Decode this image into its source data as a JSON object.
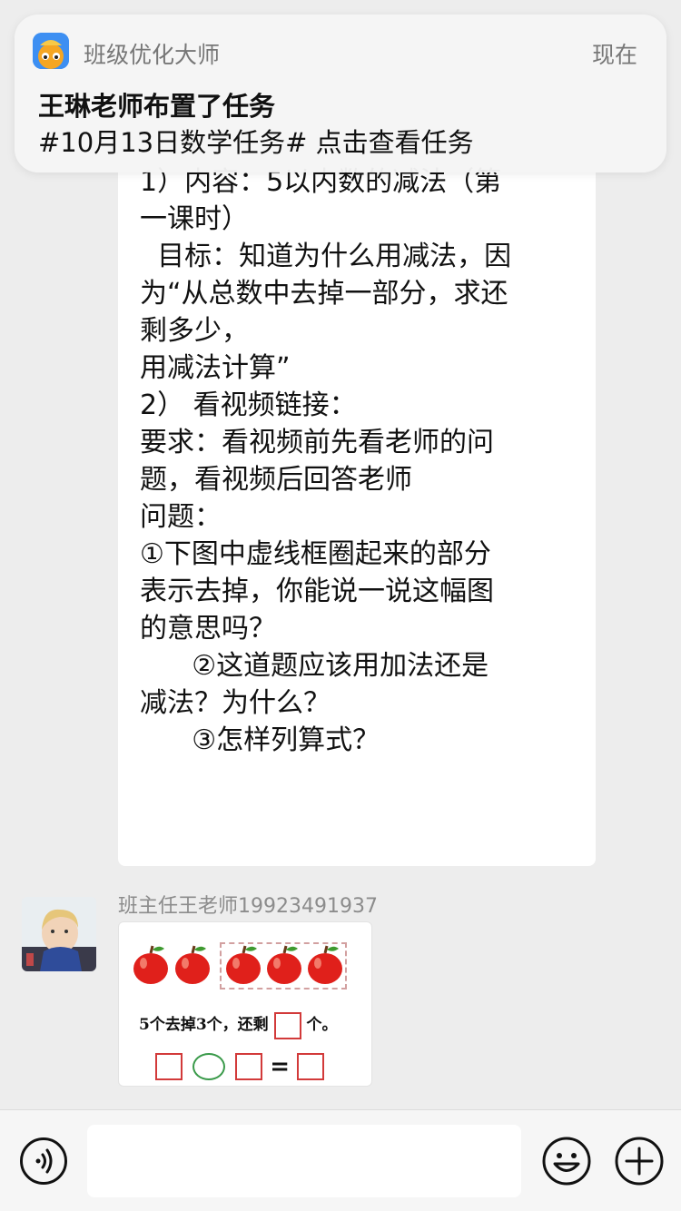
{
  "notification": {
    "app_name": "班级优化大师",
    "time": "现在",
    "title": "王琳老师布置了任务",
    "body": "#10月13日数学任务# 点击查看任务"
  },
  "messages": {
    "task_text_lines": [
      "1）内容：5以内数的减法（第",
      "一课时）",
      "  目标：知道为什么用减法，因",
      "为“从总数中去掉一部分，求还",
      "剩多少，",
      "用减法计算”",
      "2） 看视频链接：",
      "要求：看视频前先看老师的问",
      "题，看视频后回答老师",
      "",
      "问题：",
      "①下图中虚线框圈起来的部分",
      "表示去掉，你能说一说这幅图",
      "的意思吗？",
      "      ②这道题应该用加法还是",
      "减法？为什么？",
      "      ③怎样列算式？"
    ],
    "sender_name": "班主任王老师19923491937",
    "image_text": {
      "sentence_part1": "5个去掉3个，还剩",
      "sentence_part2": "个。",
      "equals": "="
    }
  },
  "input_bar": {
    "voice_icon": "voice-icon",
    "emoji_icon": "emoji-icon",
    "plus_icon": "plus-icon"
  },
  "colors": {
    "background": "#ededed",
    "bubble": "#ffffff",
    "apple_red": "#e0201b",
    "square_red": "#d23a3a",
    "circle_green": "#3a9a4a"
  }
}
